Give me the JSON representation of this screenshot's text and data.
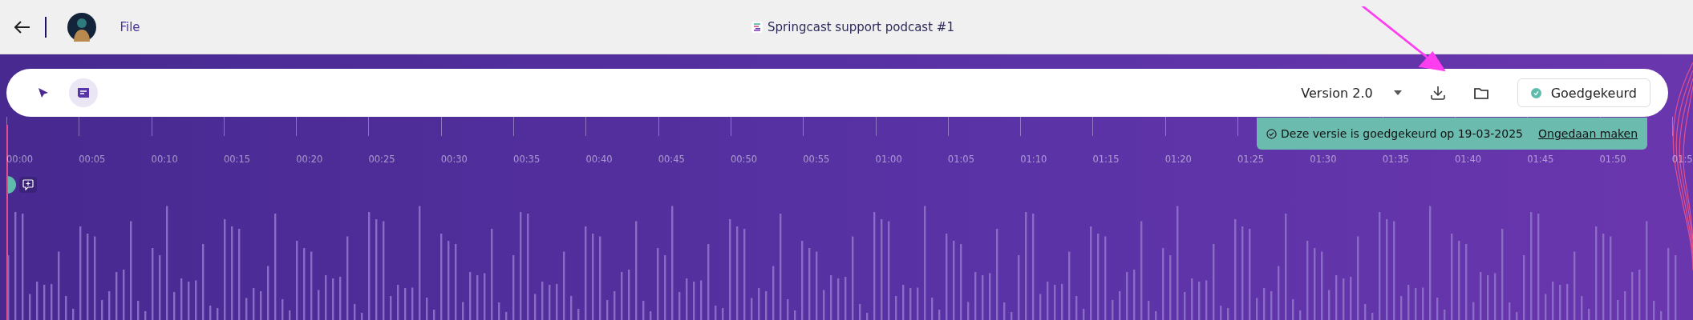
{
  "header": {
    "menu": [
      {
        "label": "File"
      }
    ],
    "title": "Springcast support podcast #1"
  },
  "toolbar": {
    "tools": [
      {
        "kind": "pointer",
        "selected": false
      },
      {
        "kind": "comment",
        "selected": true
      }
    ],
    "version": "Version 2.0",
    "status_button": {
      "label": "Goedgekeurd",
      "approved": true
    }
  },
  "banner": {
    "text": "Deze versie is goedgekeurd op 19-03-2025",
    "link": "Ongedaan maken"
  },
  "timeline": {
    "labels": [
      "00:00",
      "00:05",
      "00:10",
      "00:15",
      "00:20",
      "00:25",
      "00:30",
      "00:35",
      "00:40",
      "00:45",
      "00:50",
      "00:55",
      "01:00",
      "01:05",
      "01:10",
      "01:15",
      "01:20",
      "01:25",
      "01:30",
      "01:35",
      "01:40",
      "01:45",
      "01:50",
      "01:5"
    ]
  }
}
